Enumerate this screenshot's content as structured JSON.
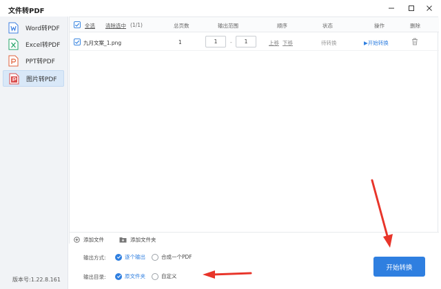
{
  "app": {
    "title": "文件转PDF"
  },
  "sidebar": {
    "items": [
      {
        "label": "Word转PDF",
        "icon": "word-doc-icon",
        "color": "#3b7de0"
      },
      {
        "label": "Excel转PDF",
        "icon": "excel-doc-icon",
        "color": "#21a366"
      },
      {
        "label": "PPT转PDF",
        "icon": "ppt-doc-icon",
        "color": "#e0603b"
      },
      {
        "label": "图片转PDF",
        "icon": "image-doc-icon",
        "color": "#d94c4c",
        "active": true
      }
    ],
    "version": "版本号:1.22.8.161"
  },
  "table": {
    "headers": {
      "select_all": "全选",
      "clear_selected": "清除选中",
      "selected_count": "(1/1)",
      "pages": "总页数",
      "range": "输出范围",
      "order": "顺序",
      "status": "状态",
      "action": "操作",
      "delete": "删除"
    },
    "rows": [
      {
        "checked": true,
        "filename": "九月文案_1.png",
        "pages": "1",
        "range_from": "1",
        "range_sep": "-",
        "range_to": "1",
        "move_up": "上移",
        "move_down": "下移",
        "status": "待转换",
        "action": "▶开始转换"
      }
    ]
  },
  "bottombar": {
    "add_file": "添加文件",
    "add_folder": "添加文件夹"
  },
  "options": {
    "output_mode_label": "输出方式:",
    "output_mode_options": [
      "逐个输出",
      "合成一个PDF"
    ],
    "output_mode_selected": 0,
    "output_dir_label": "输出目录:",
    "output_dir_options": [
      "原文件夹",
      "自定义"
    ],
    "output_dir_selected": 0
  },
  "actions": {
    "start": "开始转换"
  },
  "colors": {
    "accent": "#2f7fe0",
    "annotation_arrow": "#e8352a"
  }
}
